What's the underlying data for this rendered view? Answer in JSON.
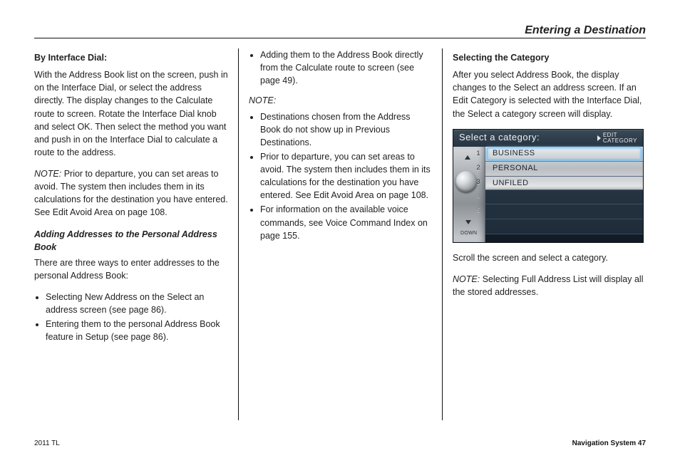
{
  "header": {
    "running_head": "Entering a Destination"
  },
  "columns": {
    "left": {
      "heading": "By Interface Dial:",
      "para1": "With the Address Book list on the screen, push in on the Interface Dial, or select the address directly. The display changes to the Calculate route to screen. Rotate the Interface Dial knob and select OK. Then select the method you want and push in on the Interface Dial to calculate a route to the address.",
      "note_label": "NOTE:",
      "note_body": "Prior to departure, you can set areas to avoid. The system then includes them in its calculations for the destination you have entered. See Edit Avoid Area on page 108.",
      "subhead": "Adding Addresses to the Personal Address Book",
      "para2": "There are three ways to enter addresses to the personal Address Book:",
      "bullets": [
        "Selecting New Address on the Select an address screen (see page 86).",
        "Entering them to the personal Address Book feature in Setup (see page 86)."
      ]
    },
    "middle": {
      "bullet1": "Adding them to the Address Book directly from the Calculate route to screen (see page 49).",
      "note_label": "NOTE:",
      "note_bullets": [
        "Destinations chosen from the Address Book do not show up in Previous Destinations.",
        "Prior to departure, you can set areas to avoid. The system then includes them in its calculations for the destination you have entered. See Edit Avoid Area on page 108.",
        "For information on the available voice commands, see Voice Command Index on page 155."
      ]
    },
    "right": {
      "heading": "Selecting the Category",
      "para_intro": "After you select Address Book, the display changes to the Select an address screen. If an Edit Category is selected with the Interface Dial, the Select a category screen will display.",
      "para_after": "Scroll the screen and select a category.",
      "note_label": "NOTE:",
      "note_body": "Selecting Full Address List will display all the stored addresses."
    }
  },
  "device": {
    "title": "Select a category:",
    "edit_label_l1": "EDIT",
    "edit_label_l2": "CATEGORY",
    "down_label": "DOWN",
    "numbers": [
      "1",
      "2",
      "3",
      "4",
      "5"
    ],
    "rows": [
      {
        "label": "BUSINESS",
        "selected": true
      },
      {
        "label": "PERSONAL",
        "selected": false
      },
      {
        "label": "UNFILED",
        "selected": false
      }
    ]
  },
  "footer": {
    "left": "2011 TL",
    "right": "Navigation System   47"
  }
}
